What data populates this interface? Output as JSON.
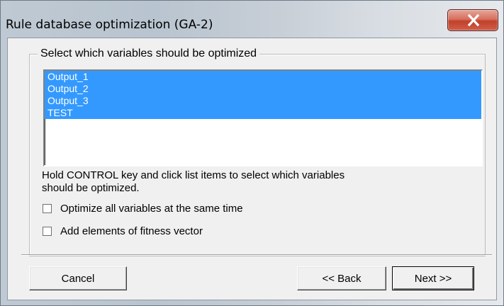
{
  "window": {
    "title": "Rule database optimization (GA-2)"
  },
  "group": {
    "legend": "Select which variables should be optimized"
  },
  "variables": {
    "items": [
      {
        "label": "Output_1",
        "selected": true
      },
      {
        "label": "Output_2",
        "selected": true
      },
      {
        "label": "Output_3",
        "selected": true
      },
      {
        "label": "TEST",
        "selected": true
      }
    ]
  },
  "hint": {
    "line1": "Hold CONTROL key and click list items to select which variables",
    "line2": "should be optimized."
  },
  "options": {
    "optimize_all_label": "Optimize all variables at the same time",
    "optimize_all_checked": false,
    "fitness_vector_label": "Add elements of fitness vector",
    "fitness_vector_checked": false
  },
  "buttons": {
    "cancel": "Cancel",
    "back": "<< Back",
    "next": "Next >>"
  },
  "colors": {
    "selection": "#3399ff",
    "dialog_bg": "#f0f0f0",
    "close_button": "#c1402b"
  },
  "icons": {
    "close": "close-icon"
  }
}
